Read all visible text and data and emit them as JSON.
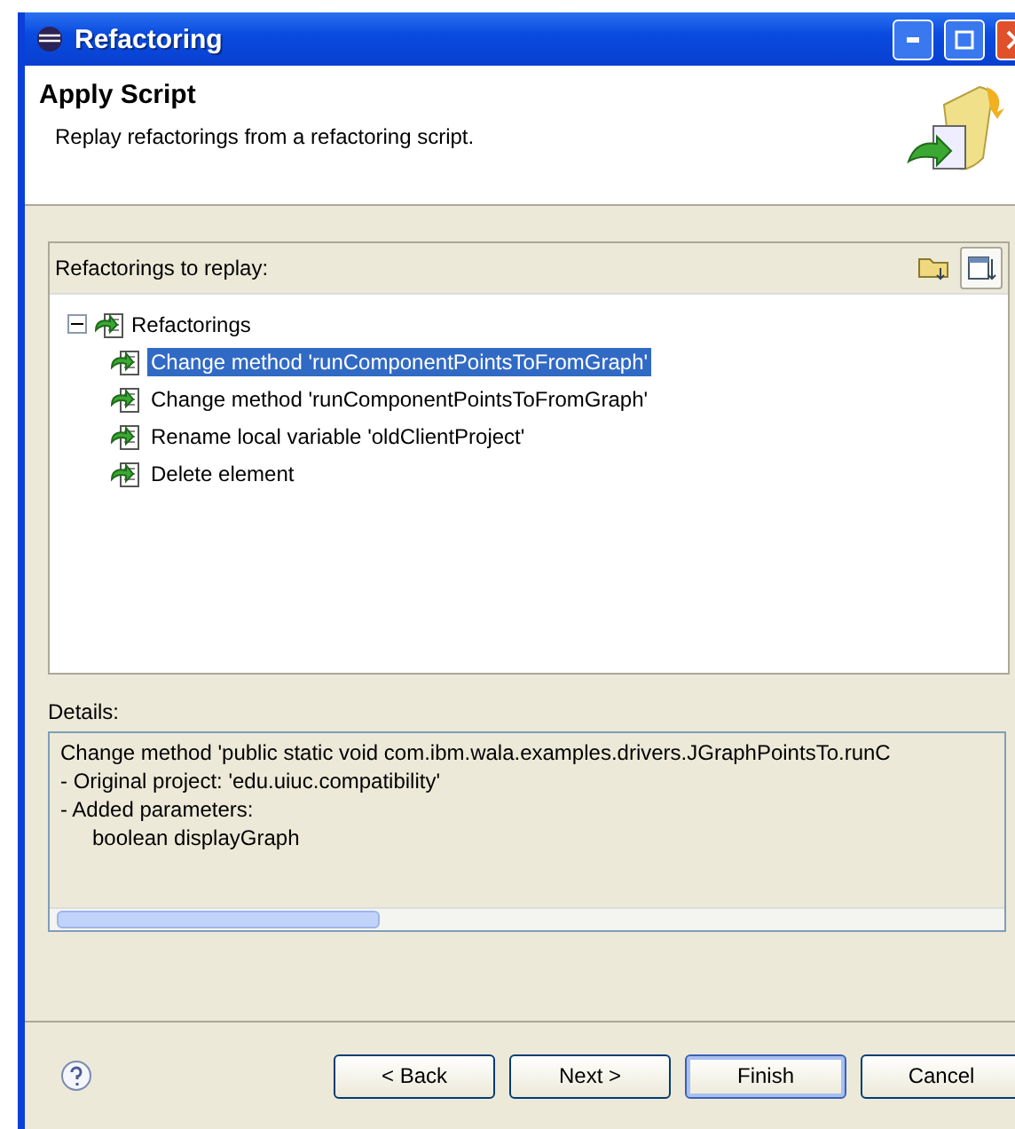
{
  "window": {
    "title": "Refactoring"
  },
  "header": {
    "title": "Apply Script",
    "description": "Replay refactorings from a refactoring script."
  },
  "refactorings_panel": {
    "label": "Refactorings to replay:",
    "tree": {
      "label": "Refactorings",
      "expanded": true,
      "children": [
        {
          "label": "Change method 'runComponentPointsToFromGraph'",
          "selected": true
        },
        {
          "label": "Change method 'runComponentPointsToFromGraph'",
          "selected": false
        },
        {
          "label": "Rename local variable 'oldClientProject'",
          "selected": false
        },
        {
          "label": "Delete element",
          "selected": false
        }
      ]
    }
  },
  "details": {
    "label": "Details:",
    "lines": [
      {
        "kind": "text",
        "text": "Change method 'public static void com.ibm.wala.examples.drivers.JGraphPointsTo.runC"
      },
      {
        "kind": "text",
        "text": "- Original project: 'edu.uiuc.compatibility'"
      },
      {
        "kind": "text",
        "text": "- Added parameters:"
      },
      {
        "kind": "param",
        "text": "boolean displayGraph"
      }
    ]
  },
  "buttons": [
    {
      "label": "< Back",
      "default": false
    },
    {
      "label": "Next >",
      "default": false
    },
    {
      "label": "Finish",
      "default": true
    },
    {
      "label": "Cancel",
      "default": false
    }
  ]
}
